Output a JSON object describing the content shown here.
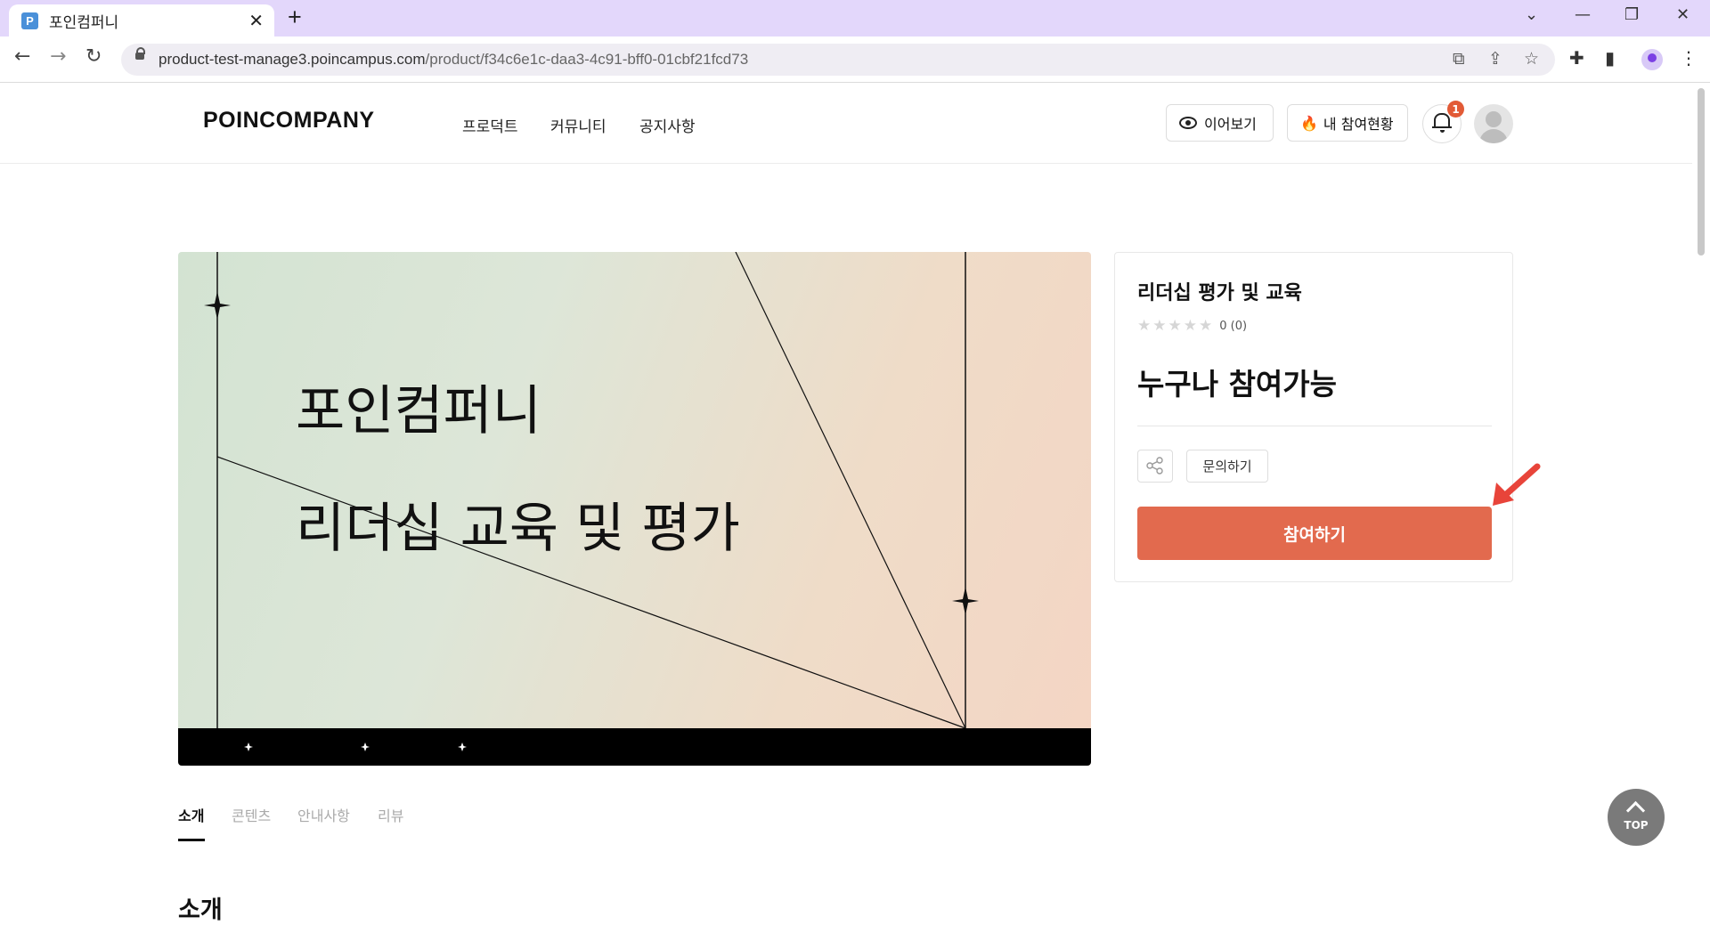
{
  "browser": {
    "tab_title": "포인컴퍼니",
    "favicon_letter": "P",
    "url_host": "product-test-manage3.poincampus.com",
    "url_path": "/product/f34c6e1c-daa3-4c91-bff0-01cbf21fcd73"
  },
  "header": {
    "logo": "POINCOMPANY",
    "nav": [
      "프로덕트",
      "커뮤니티",
      "공지사항"
    ],
    "continue_label": "이어보기",
    "my_participation_label": "내 참여현황",
    "notification_count": "1"
  },
  "hero": {
    "line1": "포인컴퍼니",
    "line2": "리더십 교육 및 평가"
  },
  "card": {
    "title": "리더십 평가 및 교육",
    "rating_text": "0 (0)",
    "stars_filled": 0,
    "stars_total": 5,
    "subtitle": "누구나 참여가능",
    "inquiry_label": "문의하기",
    "join_label": "참여하기",
    "accent_color": "#e26a4e",
    "annotation_arrow_color": "#e8443a"
  },
  "tabs": [
    "소개",
    "콘텐츠",
    "안내사항",
    "리뷰"
  ],
  "active_tab": "소개",
  "section_title": "소개",
  "top_button_label": "TOP"
}
